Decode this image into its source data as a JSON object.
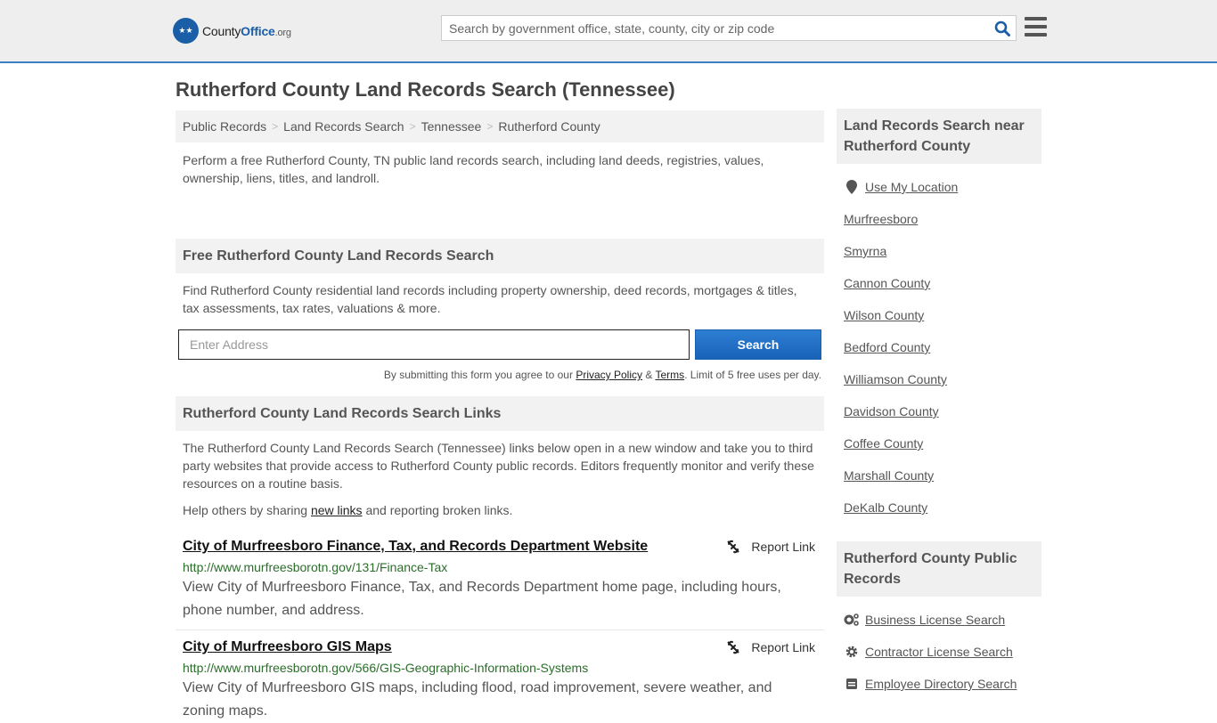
{
  "header": {
    "logo": {
      "county": "County",
      "office": "Office",
      "tld": ".org"
    },
    "search_placeholder": "Search by government office, state, county, city or zip code"
  },
  "page_title": "Rutherford County Land Records Search (Tennessee)",
  "breadcrumb": [
    "Public Records",
    "Land Records Search",
    "Tennessee",
    "Rutherford County"
  ],
  "intro": "Perform a free Rutherford County, TN public land records search, including land deeds, registries, values, ownership, liens, titles, and landroll.",
  "free_search": {
    "heading": "Free Rutherford County Land Records Search",
    "description": "Find Rutherford County residential land records including property ownership, deed records, mortgages & titles, tax assessments, tax rates, valuations & more.",
    "input_placeholder": "Enter Address",
    "button_label": "Search",
    "disclaimer_prefix": "By submitting this form you agree to our ",
    "privacy_label": "Privacy Policy",
    "amp": " & ",
    "terms_label": "Terms",
    "disclaimer_suffix": ". Limit of 5 free uses per day."
  },
  "links_section": {
    "heading": "Rutherford County Land Records Search Links",
    "description": "The Rutherford County Land Records Search (Tennessee) links below open in a new window and take you to third party websites that provide access to Rutherford County public records. Editors frequently monitor and verify these resources on a routine basis.",
    "help_prefix": "Help others by sharing ",
    "help_link": "new links",
    "help_suffix": " and reporting broken links.",
    "report_label": "Report Link",
    "items": [
      {
        "title": "City of Murfreesboro Finance, Tax, and Records Department Website",
        "url": "http://www.murfreesborotn.gov/131/Finance-Tax",
        "description": "View City of Murfreesboro Finance, Tax, and Records Department home page, including hours, phone number, and address."
      },
      {
        "title": "City of Murfreesboro GIS Maps",
        "url": "http://www.murfreesborotn.gov/566/GIS-Geographic-Information-Systems",
        "description": "View City of Murfreesboro GIS maps, including flood, road improvement, severe weather, and zoning maps."
      }
    ]
  },
  "sidebar": {
    "nearby_heading": "Land Records Search near Rutherford County",
    "use_location": "Use My Location",
    "nearby": [
      "Murfreesboro",
      "Smyrna",
      "Cannon County",
      "Wilson County",
      "Bedford County",
      "Williamson County",
      "Davidson County",
      "Coffee County",
      "Marshall County",
      "DeKalb County"
    ],
    "public_heading": "Rutherford County Public Records",
    "public_records": [
      {
        "label": "Business License Search",
        "icon": "gears-icon"
      },
      {
        "label": "Contractor License Search",
        "icon": "gear-icon"
      },
      {
        "label": "Employee Directory Search",
        "icon": "id-card-icon"
      }
    ]
  }
}
